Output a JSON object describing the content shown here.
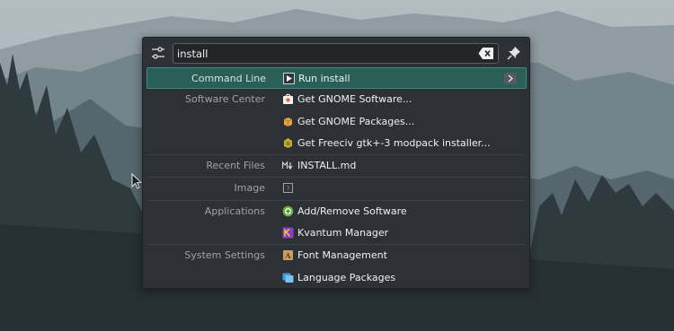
{
  "search": {
    "query": "install"
  },
  "icons": {
    "config": "configure-sliders-icon",
    "clear": "backspace-clear-icon",
    "pin": "pin-icon"
  },
  "results": [
    {
      "category": "Command Line",
      "label": "Run install",
      "icon": "run-command-icon",
      "selected": true
    },
    {
      "category": "Software Center",
      "label": "Get GNOME Software...",
      "icon": "software-store-icon"
    },
    {
      "category": "",
      "label": "Get GNOME Packages...",
      "icon": "package-icon"
    },
    {
      "category": "",
      "label": "Get Freeciv gtk+-3 modpack installer...",
      "icon": "freeciv-icon"
    },
    {
      "category": "Recent Files",
      "label": "INSTALL.md",
      "icon": "markdown-file-icon"
    },
    {
      "category": "Image",
      "label": "",
      "icon": "image-file-icon"
    },
    {
      "category": "Applications",
      "label": "Add/Remove Software",
      "icon": "add-remove-software-icon"
    },
    {
      "category": "",
      "label": "Kvantum Manager",
      "icon": "kvantum-icon"
    },
    {
      "category": "System Settings",
      "label": "Font Management",
      "icon": "font-management-icon"
    },
    {
      "category": "",
      "label": "Language Packages",
      "icon": "language-packages-icon"
    }
  ],
  "colors": {
    "panel": "#2d3135",
    "selection": "#2a5f58",
    "category_text": "#9ea3a8"
  }
}
